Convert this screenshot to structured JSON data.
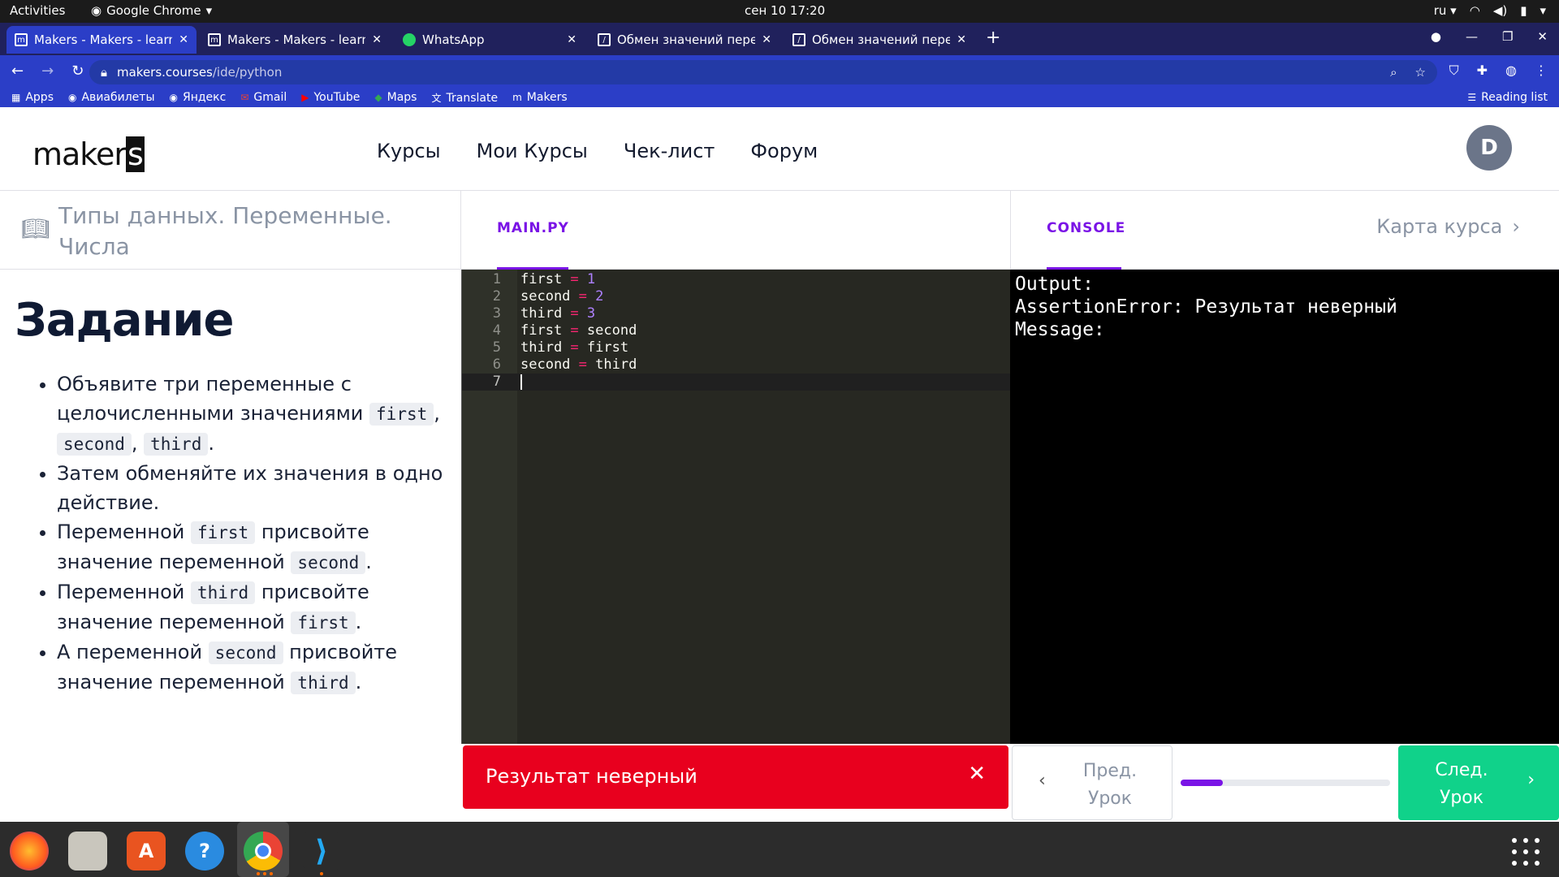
{
  "os": {
    "activities": "Activities",
    "app_name": "Google Chrome",
    "clock": "сен 10  17:20",
    "lang": "ru"
  },
  "browser": {
    "tabs": [
      {
        "title": "Makers - Makers - learn every",
        "active": true
      },
      {
        "title": "Makers - Makers - learn every",
        "active": false
      },
      {
        "title": "WhatsApp",
        "active": false
      },
      {
        "title": "Обмен значений переменных",
        "active": false
      },
      {
        "title": "Обмен значений переменных",
        "active": false
      }
    ],
    "url_host": "makers.courses",
    "url_path": "/ide/python",
    "bookmarks": [
      "Apps",
      "Авиабилеты",
      "Яндекс",
      "Gmail",
      "YouTube",
      "Maps",
      "Translate",
      "Makers"
    ],
    "reading_list": "Reading list"
  },
  "site": {
    "logo_main": "maker",
    "logo_box": "s",
    "menu": [
      "Курсы",
      "Мои Курсы",
      "Чек-лист",
      "Форум"
    ],
    "avatar_letter": "D"
  },
  "lesson": {
    "title": "Типы данных. Переменные. Числа",
    "task_heading": "Задание",
    "items": [
      {
        "before": "Объявите три переменные с целочисленными значениями ",
        "c1": "first",
        "mid1": ", ",
        "c2": "second",
        "mid2": ", ",
        "c3": "third",
        "after": "."
      },
      {
        "text": "Затем обменяйте их значения в одно действие."
      },
      {
        "before": "Переменной ",
        "c1": "first",
        "mid1": " присвойте значение переменной ",
        "c2": "second",
        "after": "."
      },
      {
        "before": "Переменной ",
        "c1": "third",
        "mid1": " присвойте значение переменной ",
        "c2": "first",
        "after": "."
      },
      {
        "before": "А переменной ",
        "c1": "second",
        "mid1": " присвойте значение переменной ",
        "c2": "third",
        "after": "."
      }
    ]
  },
  "editor": {
    "tab_label": "MAIN.PY",
    "lines": [
      {
        "n": "1",
        "var": "first",
        "val": "1",
        "val_is_num": true
      },
      {
        "n": "2",
        "var": "second",
        "val": "2",
        "val_is_num": true
      },
      {
        "n": "3",
        "var": "third",
        "val": "3",
        "val_is_num": true
      },
      {
        "n": "4",
        "var": "first",
        "val": "second",
        "val_is_num": false
      },
      {
        "n": "5",
        "var": "third",
        "val": "first",
        "val_is_num": false
      },
      {
        "n": "6",
        "var": "second",
        "val": "third",
        "val_is_num": false
      },
      {
        "n": "7",
        "var": "",
        "val": "",
        "val_is_num": false
      }
    ]
  },
  "console": {
    "tab_label": "CONSOLE",
    "course_map": "Карта курса",
    "output": [
      "Output:",
      "AssertionError: Результат неверный",
      "Message:"
    ]
  },
  "footer": {
    "error_message": "Результат неверный",
    "close_symbol": "✕",
    "prev_label_1": "Пред.",
    "prev_label_2": "Урок",
    "next_label_1": "След.",
    "next_label_2": "Урок",
    "progress": 0.2
  },
  "colors": {
    "accent": "#7a14e6",
    "error": "#e8001e",
    "success": "#10d28a",
    "browser_chrome": "#2b3ec7"
  }
}
